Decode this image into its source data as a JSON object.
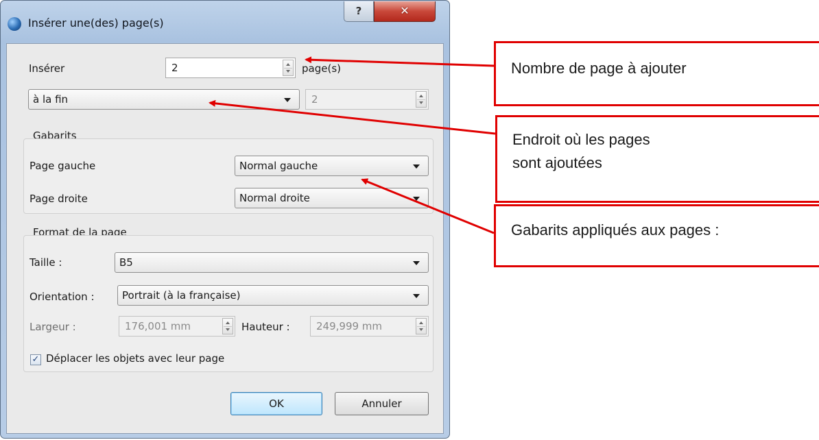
{
  "window": {
    "title": "Insérer une(des) page(s)",
    "help_glyph": "?",
    "close_glyph": "✕"
  },
  "insert": {
    "label": "Insérer",
    "count": "2",
    "unit_label": "page(s)",
    "position": "à la fin",
    "position_page": "2"
  },
  "templates": {
    "group_label": "Gabarits",
    "left_label": "Page gauche",
    "left_value": "Normal gauche",
    "right_label": "Page droite",
    "right_value": "Normal droite"
  },
  "format": {
    "group_label": "Format de la page",
    "size_label": "Taille :",
    "size_value": "B5",
    "orientation_label": "Orientation :",
    "orientation_value": "Portrait (à la française)",
    "width_label": "Largeur :",
    "width_value": "176,001 mm",
    "height_label": "Hauteur :",
    "height_value": "249,999 mm",
    "move_objects_label": "Déplacer les objets avec leur page",
    "move_objects_checked": true
  },
  "buttons": {
    "ok": "OK",
    "cancel": "Annuler"
  },
  "annotations": {
    "count_note": "Nombre de page à ajouter",
    "position_note": "Endroit où les pages sont ajoutées",
    "templates_note": "Gabarits appliqués aux pages :"
  },
  "colors": {
    "annotation_red": "#e00000",
    "window_frame": "#a9c2e0",
    "close_button": "#c9483a"
  }
}
